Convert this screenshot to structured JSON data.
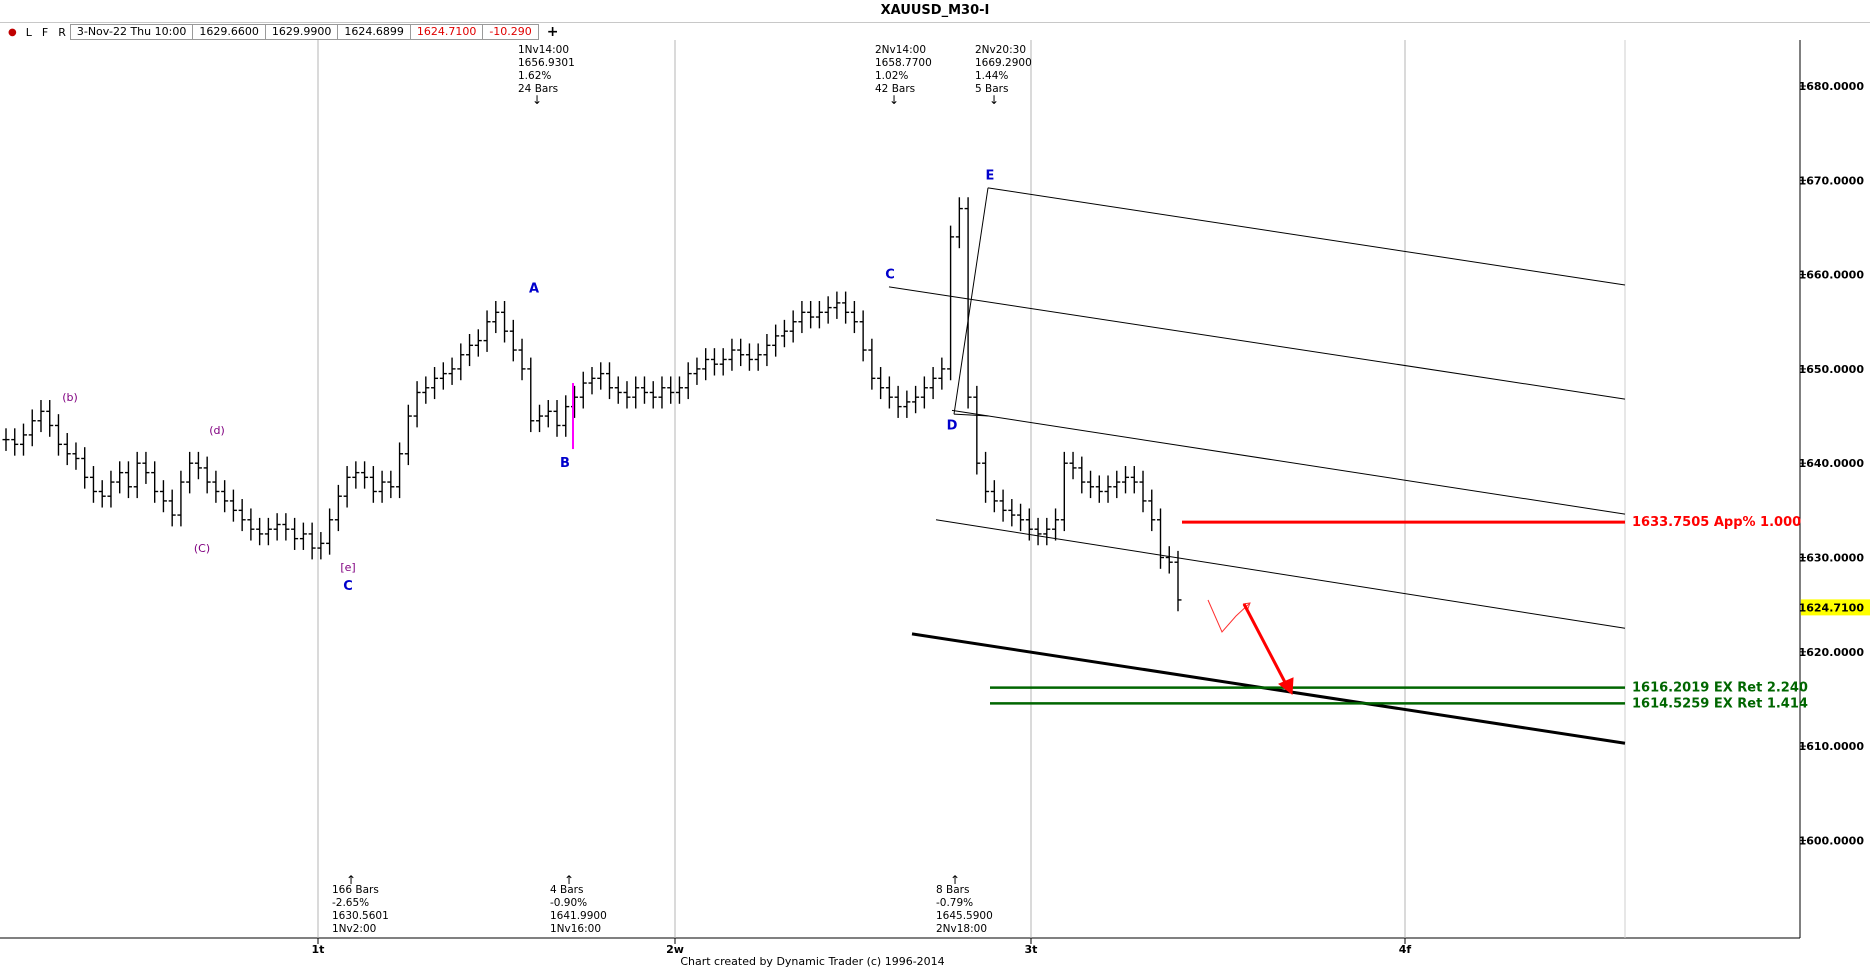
{
  "header": {
    "title": "XAUUSD_M30-I",
    "buttons": [
      "L",
      "F",
      "R"
    ],
    "ohlc": {
      "date": "3-Nov-22 Thu 10:00",
      "open": "1629.6600",
      "high": "1629.9900",
      "low": "1624.6899",
      "close": "1624.7100",
      "change": "-10.290"
    }
  },
  "footer": "Chart created by Dynamic Trader  (c)  1996-2014",
  "chart_data": {
    "type": "bar",
    "symbol": "XAUUSD_M30-I",
    "y_axis": {
      "min": 1590,
      "max": 1685,
      "ticks": [
        "1600.0000",
        "1610.0000",
        "1620.0000",
        "1630.0000",
        "1640.0000",
        "1650.0000",
        "1660.0000",
        "1670.0000",
        "1680.0000"
      ],
      "side": "right"
    },
    "x_axis": {
      "labels": [
        "1t",
        "2w",
        "3t",
        "4f"
      ]
    },
    "last_price": "1624.7100",
    "series": [
      {
        "name": "price",
        "values": [
          1642.5,
          1642,
          1643,
          1644.5,
          1645.5,
          1644,
          1642,
          1641,
          1640.5,
          1638.5,
          1637,
          1636.5,
          1638,
          1639,
          1637.5,
          1640,
          1639,
          1637,
          1636,
          1634.5,
          1638,
          1640,
          1639.5,
          1638,
          1637,
          1636,
          1635,
          1634,
          1633,
          1632.5,
          1633,
          1633.5,
          1633,
          1632,
          1632.5,
          1631,
          1631.5,
          1634,
          1636.5,
          1638.5,
          1639,
          1638.5,
          1637,
          1638,
          1637.5,
          1641,
          1645,
          1647.5,
          1648,
          1649,
          1649.5,
          1650,
          1651.5,
          1652.5,
          1653,
          1655,
          1656,
          1654,
          1652,
          1650,
          1644.5,
          1645,
          1645.5,
          1644,
          1646,
          1647,
          1648.5,
          1649,
          1649.5,
          1648,
          1647.5,
          1647,
          1648,
          1647.5,
          1647,
          1648,
          1647.5,
          1648,
          1649.5,
          1650,
          1651,
          1650.5,
          1651,
          1652,
          1651.5,
          1651,
          1651.5,
          1652.5,
          1653.5,
          1654,
          1655,
          1656,
          1655.5,
          1656,
          1656.5,
          1657,
          1656,
          1655,
          1652,
          1649,
          1648,
          1647,
          1646,
          1646.5,
          1647,
          1648,
          1649,
          1650,
          1664,
          1667,
          1647,
          1640,
          1637,
          1636,
          1635,
          1634.5,
          1634,
          1633,
          1632.5,
          1633,
          1634,
          1640,
          1639.5,
          1638,
          1637.5,
          1637,
          1637.5,
          1638,
          1638.5,
          1638,
          1636,
          1634,
          1630,
          1629.5,
          1625.5
        ]
      }
    ],
    "bar_labels": [
      {
        "text": "(b)",
        "value": 1647,
        "color": "#800080"
      },
      {
        "text": "(d)",
        "value": 1643.5,
        "color": "#800080"
      },
      {
        "text": "(C)",
        "value": 1631,
        "color": "#800080"
      },
      {
        "text": "[e]",
        "value": 1629,
        "color": "#800080"
      },
      {
        "text": "C",
        "value": 1627,
        "color": "#0000cc"
      },
      {
        "text": "A",
        "value": 1658.5,
        "color": "#0000cc"
      },
      {
        "text": "B",
        "value": 1640,
        "color": "#0000cc"
      },
      {
        "text": "C",
        "value": 1660,
        "color": "#0000cc"
      },
      {
        "text": "D",
        "value": 1644,
        "color": "#0000cc"
      },
      {
        "text": "E",
        "value": 1670.5,
        "color": "#0000cc"
      }
    ],
    "top_annotations": [
      {
        "lines": [
          "1Nv14:00",
          "1656.9301",
          "1.62%",
          "24 Bars"
        ]
      },
      {
        "lines": [
          "2Nv14:00",
          "1658.7700",
          "1.02%",
          "42 Bars"
        ]
      },
      {
        "lines": [
          "2Nv20:30",
          "1669.2900",
          "1.44%",
          "5 Bars"
        ]
      }
    ],
    "bottom_annotations": [
      {
        "lines": [
          "166 Bars",
          "-2.65%",
          "1630.5601",
          "1Nv2:00"
        ]
      },
      {
        "lines": [
          "4 Bars",
          "-0.90%",
          "1641.9900",
          "1Nv16:00"
        ]
      },
      {
        "lines": [
          "8 Bars",
          "-0.79%",
          "1645.5900",
          "2Nv18:00"
        ]
      }
    ],
    "levels": [
      {
        "label": "1633.7505 App% 1.000",
        "value": 1633.7505,
        "color": "#ff0000"
      },
      {
        "label": "1616.2019 EX Ret 2.240",
        "value": 1616.2019,
        "color": "#006600"
      },
      {
        "label": "1614.5259 EX Ret 1.414",
        "value": 1614.5259,
        "color": "#006600"
      }
    ]
  }
}
